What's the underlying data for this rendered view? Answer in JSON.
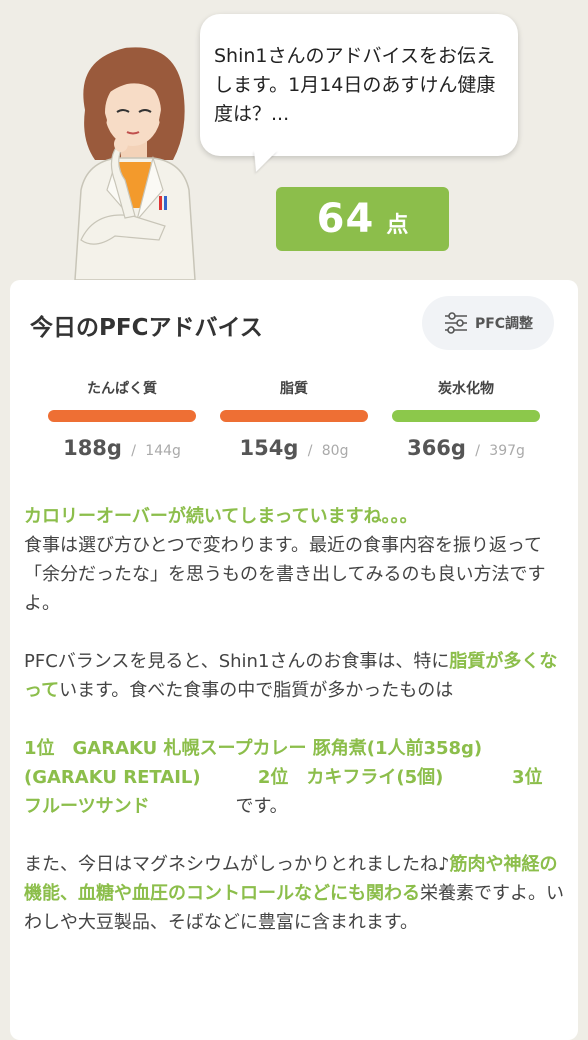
{
  "advisor": {
    "message": "Shin1さんのアドバイスをお伝えします。1月14日のあすけん健康度は？..."
  },
  "score": {
    "value": "64",
    "unit": "点"
  },
  "card": {
    "title": "今日のPFCアドバイス",
    "adjust_button": "PFC調整"
  },
  "pfc": [
    {
      "label": "たんぱく質",
      "value": "188g",
      "sep": "/",
      "target": "144g",
      "color": "#ee6f34"
    },
    {
      "label": "脂質",
      "value": "154g",
      "sep": "/",
      "target": "80g",
      "color": "#ee6f34"
    },
    {
      "label": "炭水化物",
      "value": "366g",
      "sep": "/",
      "target": "397g",
      "color": "#8cc84b"
    }
  ],
  "advice": {
    "headline": "カロリーオーバーが続いてしまっていますね。。。",
    "p1": "食事は選び方ひとつで変わります。最近の食事内容を振り返って「余分だったな」を思うものを書き出してみるのも良い方法ですよ。",
    "p2_a": "PFCバランスを見ると、Shin1さんのお食事は、特に",
    "p2_hl": "脂質が多くなって",
    "p2_b": "います。食べた食事の中で脂質が多かったものは",
    "rank1": "1位　GARAKU 札幌スープカレー 豚角煮(1人前358g)(GARAKU RETAIL)",
    "rank2": "2位　カキフライ(5個)",
    "rank3": "3位　フルーツサンド",
    "rank_tail": "です。",
    "p3_a": "また、今日はマグネシウムがしっかりとれましたね♪",
    "p3_hl": "筋肉や神経の機能、血糖や血圧のコントロールなどにも関わる",
    "p3_b": "栄養素ですよ。いわしや大豆製品、そばなどに豊富に含まれます。"
  }
}
